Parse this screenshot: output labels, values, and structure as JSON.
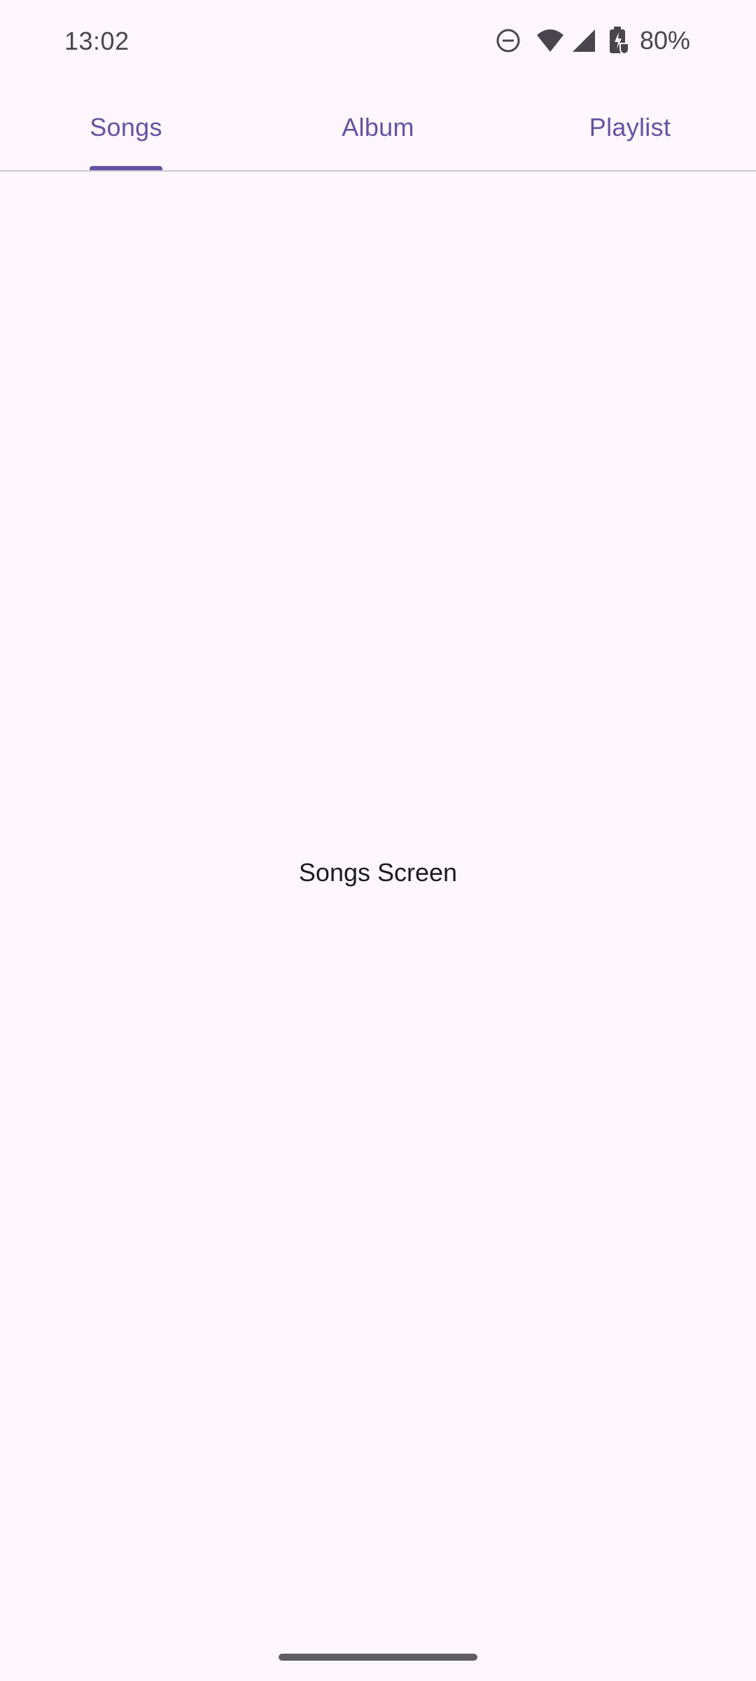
{
  "status_bar": {
    "time": "13:02",
    "battery": "80%",
    "icons": [
      "do-not-disturb-icon",
      "wifi-icon",
      "cellular-signal-icon",
      "battery-charging-icon"
    ]
  },
  "tabs": [
    {
      "label": "Songs",
      "selected": true
    },
    {
      "label": "Album",
      "selected": false
    },
    {
      "label": "Playlist",
      "selected": false
    }
  ],
  "content": {
    "text": "Songs Screen"
  },
  "colors": {
    "accent": "#6750A4",
    "background": "#FDF7FD",
    "divider": "#CAC4D0",
    "status_icon": "#49454F"
  }
}
